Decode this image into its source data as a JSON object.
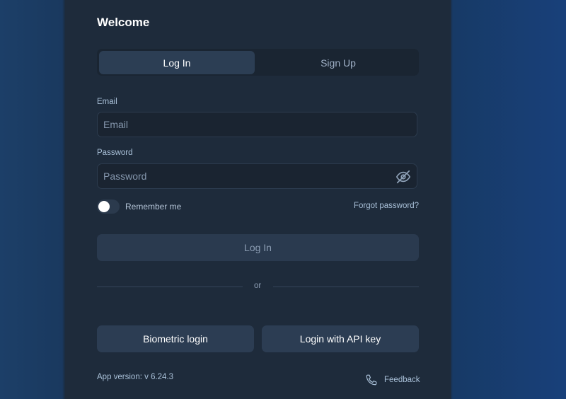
{
  "title": "Welcome",
  "tabs": [
    {
      "label": "Log In",
      "active": true
    },
    {
      "label": "Sign Up",
      "active": false
    }
  ],
  "email": {
    "label": "Email",
    "placeholder": "Email",
    "value": ""
  },
  "password": {
    "label": "Password",
    "placeholder": "Password",
    "value": "",
    "toggle_icon": "eye-off-icon"
  },
  "remember": {
    "label": "Remember me",
    "checked": false
  },
  "forgot_label": "Forgot password?",
  "submit_label": "Log In",
  "divider_text": "or",
  "alt_buttons": {
    "biometric_label": "Biometric login",
    "api_key_label": "Login with API key"
  },
  "footer": {
    "version": "App version: v 6.24.3",
    "feedback_label": "Feedback",
    "feedback_icon": "phone-icon"
  },
  "colors": {
    "accent_text": "#a9c0d8",
    "panel_bg": "#1e2b3b",
    "button_bg": "#2c3d53"
  }
}
